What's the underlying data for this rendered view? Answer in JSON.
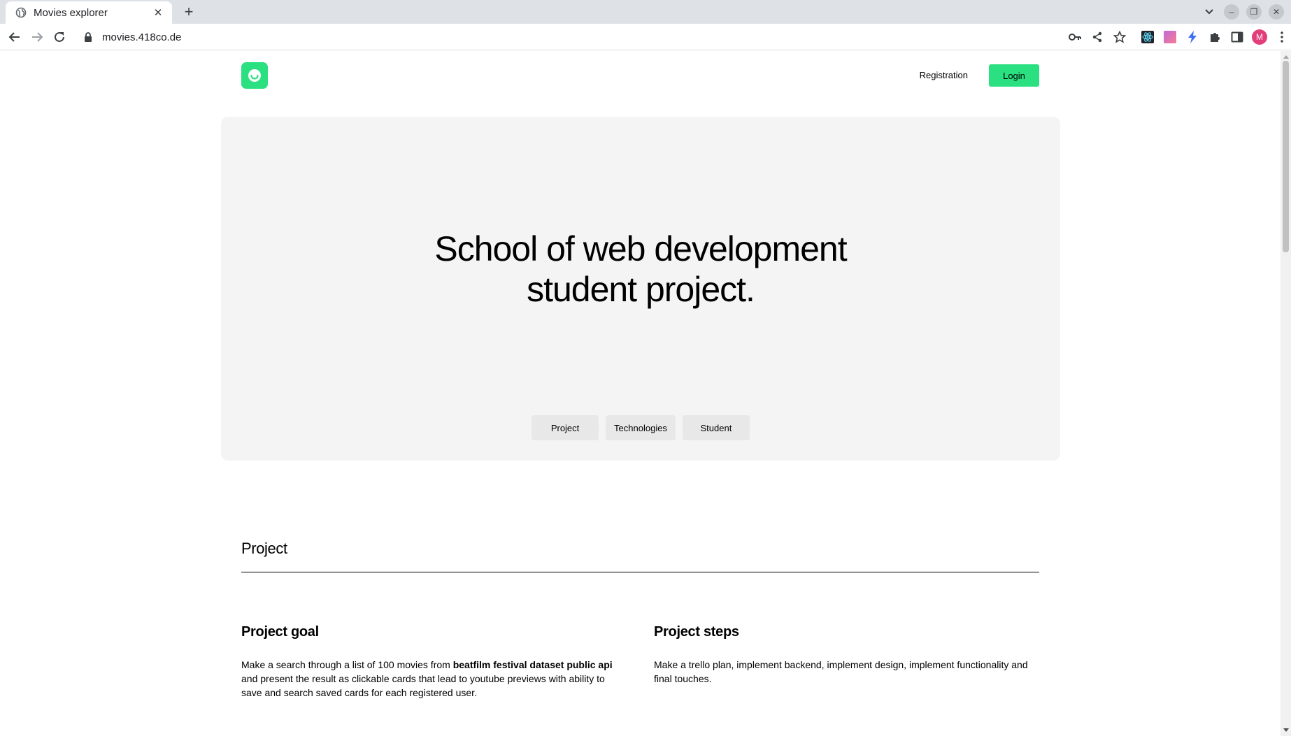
{
  "browser": {
    "tab_title": "Movies explorer",
    "url": "movies.418co.de",
    "avatar_letter": "M"
  },
  "header": {
    "registration_label": "Registration",
    "login_label": "Login"
  },
  "hero": {
    "title_line1": "School of web development",
    "title_line2": "student project.",
    "links": [
      "Project",
      "Technologies",
      "Student"
    ]
  },
  "project": {
    "section_title": "Project",
    "goal": {
      "title": "Project goal",
      "text_before": "Make a search through a list of 100 movies from ",
      "text_bold": "beatfilm festival dataset public api",
      "text_after": " and present the result as clickable cards that lead to youtube previews with ability to save and search saved cards for each registered user."
    },
    "steps": {
      "title": "Project steps",
      "text": "Make a trello plan, implement backend, implement design, implement functionality and final touches."
    }
  },
  "colors": {
    "accent": "#2be080",
    "hero_bg": "#f4f4f4",
    "hero_link_bg": "#e8e8e8",
    "avatar": "#e23e79"
  }
}
